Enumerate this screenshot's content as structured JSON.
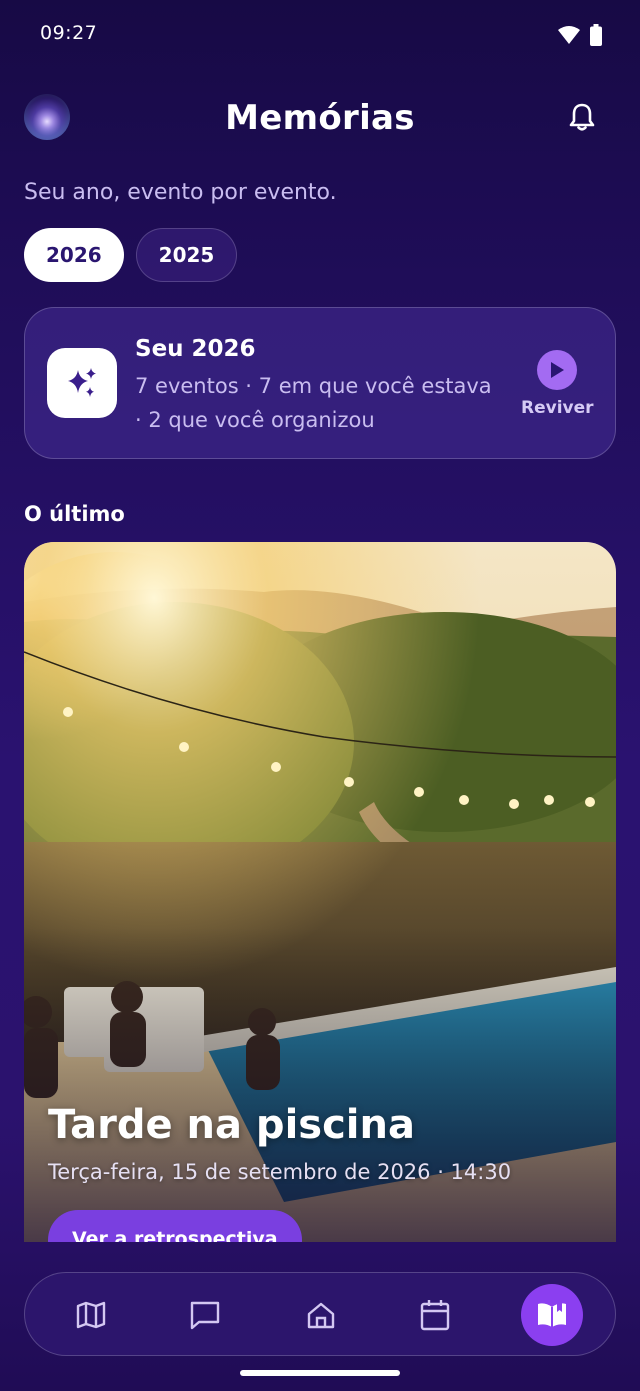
{
  "status_bar": {
    "time": "09:27",
    "icons": [
      "wifi-icon",
      "battery-icon"
    ]
  },
  "header": {
    "title": "Memórias",
    "avatar_icon": "avatar",
    "bell_icon": "bell-icon"
  },
  "subtitle": "Seu ano, evento por evento.",
  "year_tabs": [
    {
      "label": "2026",
      "selected": true
    },
    {
      "label": "2025",
      "selected": false
    }
  ],
  "summary_card": {
    "icon": "sparkles-icon",
    "title": "Seu 2026",
    "line1": "7 eventos · 7 em que você estava",
    "line2": "· 2 que você organizou",
    "replay_label": "Reviver"
  },
  "section_label": "O último",
  "featured_event": {
    "title": "Tarde na piscina",
    "date": "Terça-feira, 15 de setembro de 2026 · 14:30",
    "button_label": "Ver a retrospectiva"
  },
  "bottom_nav": {
    "items": [
      {
        "icon": "map-icon",
        "active": false
      },
      {
        "icon": "chat-icon",
        "active": false
      },
      {
        "icon": "home-icon",
        "active": false
      },
      {
        "icon": "calendar-icon",
        "active": false
      },
      {
        "icon": "memories-book-icon",
        "active": true
      }
    ]
  },
  "colors": {
    "accent": "#8b3ff0",
    "background_top": "#170a45",
    "background_mid": "#2a1270",
    "muted_text": "#c9bdf0"
  }
}
